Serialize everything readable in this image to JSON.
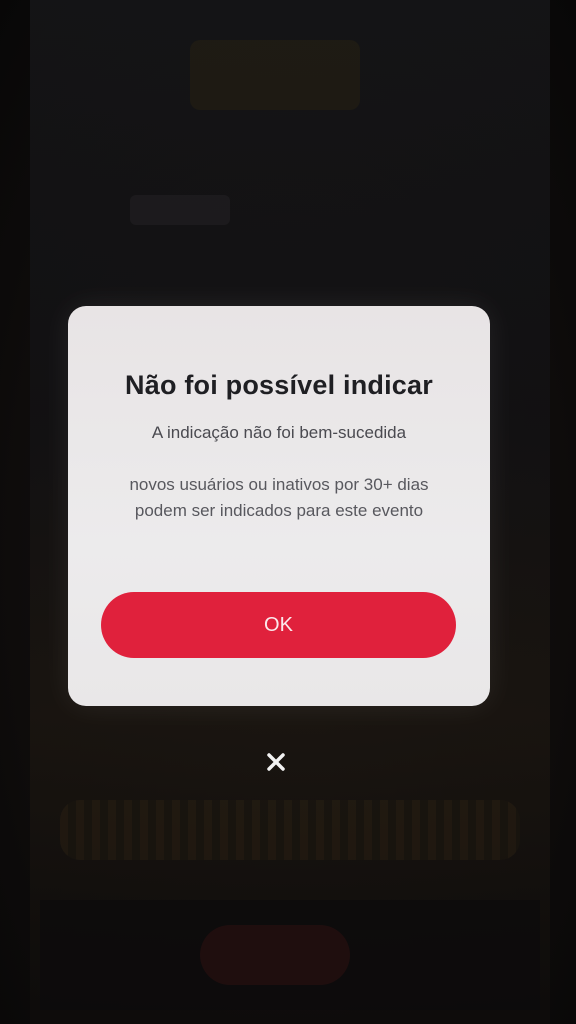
{
  "dialog": {
    "title": "Não foi possível indicar",
    "subtitle": "A indicação não foi bem-sucedida",
    "message": "novos usuários ou inativos por 30+ dias podem ser indicados para este evento",
    "ok_label": "OK"
  },
  "close": {
    "icon": "close-icon"
  },
  "colors": {
    "accent": "#e0213c",
    "dialog_bg": "#ebe9ea",
    "overlay": "#0b0a0a"
  }
}
